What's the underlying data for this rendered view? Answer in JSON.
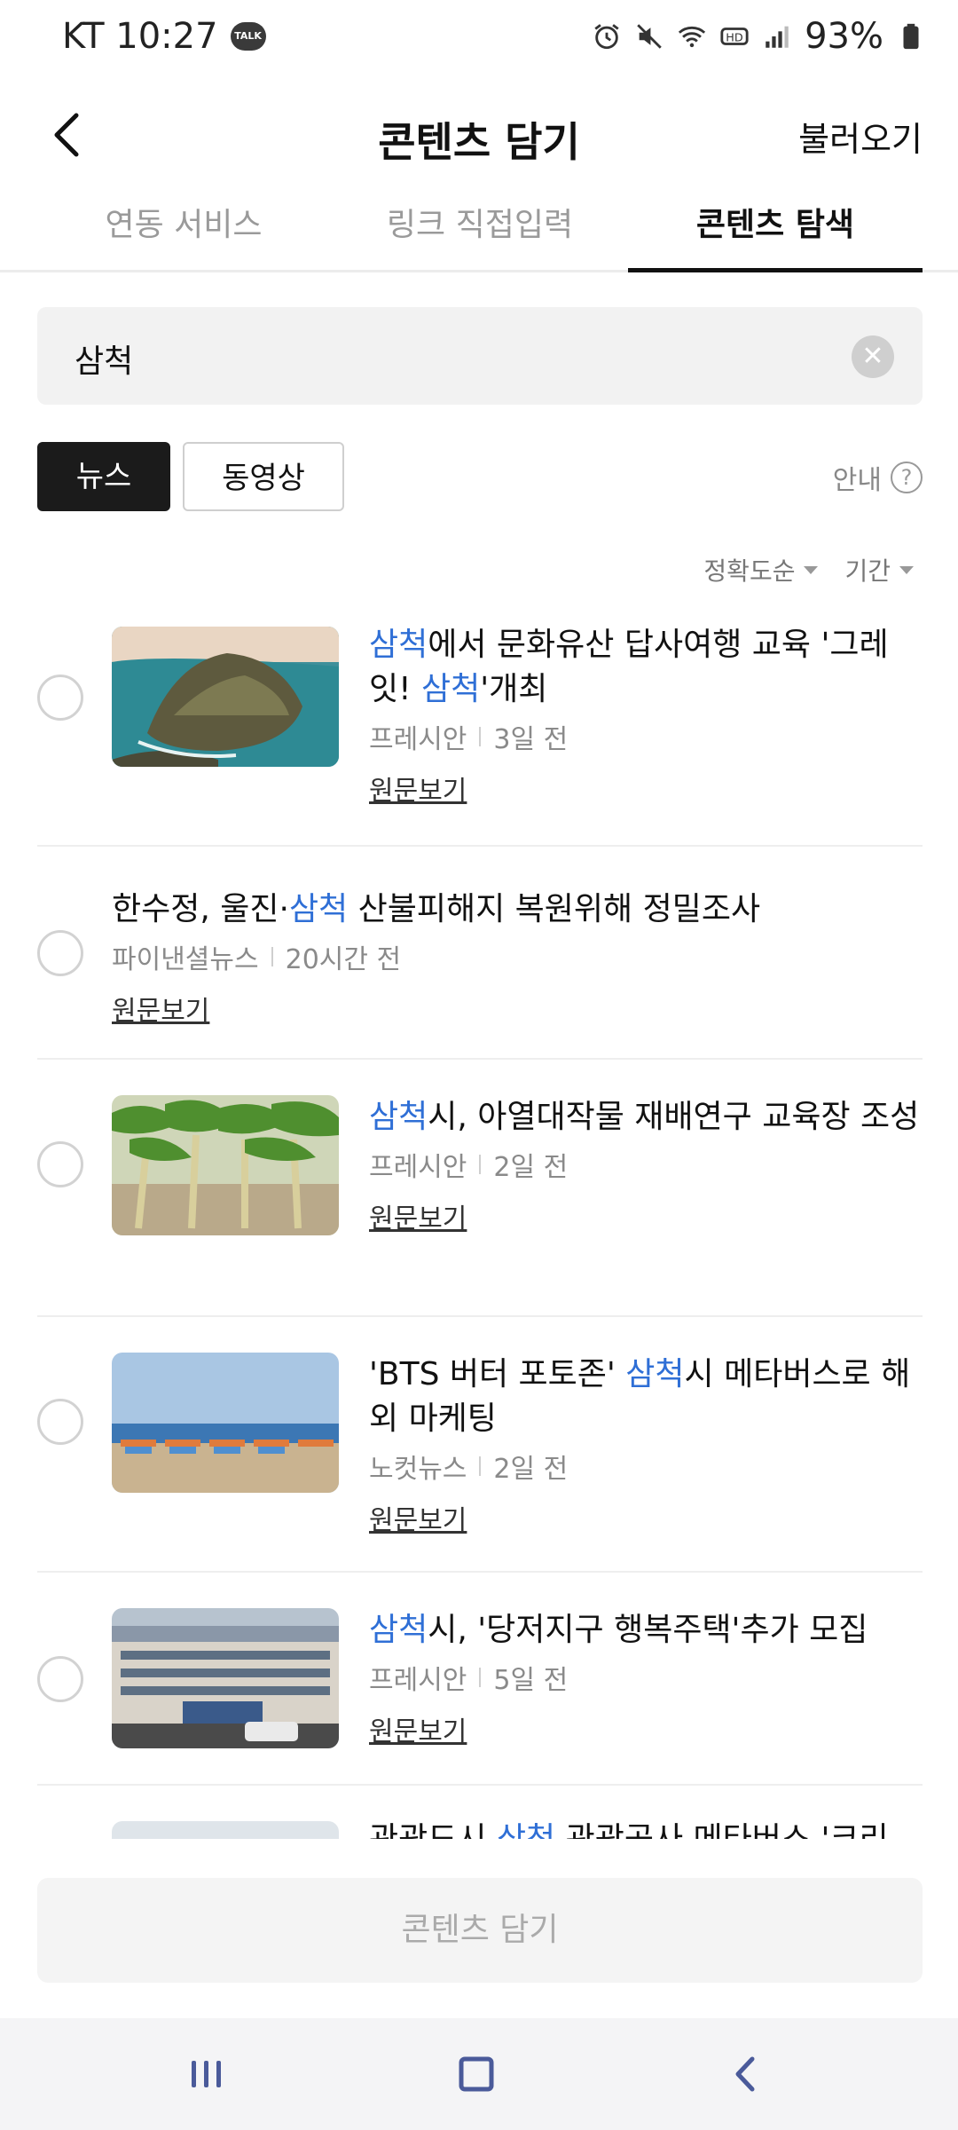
{
  "status": {
    "carrier_time": "KT 10:27",
    "talk_badge": "TALK",
    "battery": "93%"
  },
  "header": {
    "title": "콘텐츠 담기",
    "load_label": "불러오기"
  },
  "tabs": [
    {
      "label": "연동 서비스",
      "active": false
    },
    {
      "label": "링크 직접입력",
      "active": false
    },
    {
      "label": "콘텐츠 탐색",
      "active": true
    }
  ],
  "search": {
    "value": "삼척"
  },
  "filters": {
    "news": "뉴스",
    "video": "동영상",
    "guide": "안내",
    "sort_accuracy": "정확도순",
    "sort_period": "기간"
  },
  "articles": [
    {
      "title_parts": [
        "",
        "삼척",
        "에서 문화유산 답사여행 교육 '그레잇! ",
        "삼척",
        "'개최"
      ],
      "source": "프레시안",
      "time": "3일 전",
      "link": "원문보기",
      "thumb": "island-icon"
    },
    {
      "title_parts": [
        "한수정, 울진·",
        "삼척",
        " 산불피해지 복원위해 정밀조사"
      ],
      "source": "파이낸셜뉴스",
      "time": "20시간 전",
      "link": "원문보기"
    },
    {
      "title_parts": [
        "",
        "삼척",
        "시, 아열대작물 재배연구 교육장 조성"
      ],
      "source": "프레시안",
      "time": "2일 전",
      "link": "원문보기",
      "thumb": "banana-icon"
    },
    {
      "title_parts": [
        "'BTS 버터 포토존' ",
        "삼척",
        "시 메타버스로 해외 마케팅"
      ],
      "source": "노컷뉴스",
      "time": "2일 전",
      "link": "원문보기",
      "thumb": "beach-icon"
    },
    {
      "title_parts": [
        "",
        "삼척",
        "시, '당저지구 행복주택'추가 모집"
      ],
      "source": "프레시안",
      "time": "5일 전",
      "link": "원문보기",
      "thumb": "building-icon"
    },
    {
      "title_parts": [
        "관광도시 ",
        "삼척",
        " 관광공사 메타버스 '크리"
      ],
      "source": "",
      "time": "",
      "link": ""
    }
  ],
  "cta": {
    "label": "콘텐츠 담기"
  },
  "colors": {
    "highlight": "#2f6fd6",
    "active_tab": "#111111",
    "inactive_tab": "#9a9a9a"
  }
}
